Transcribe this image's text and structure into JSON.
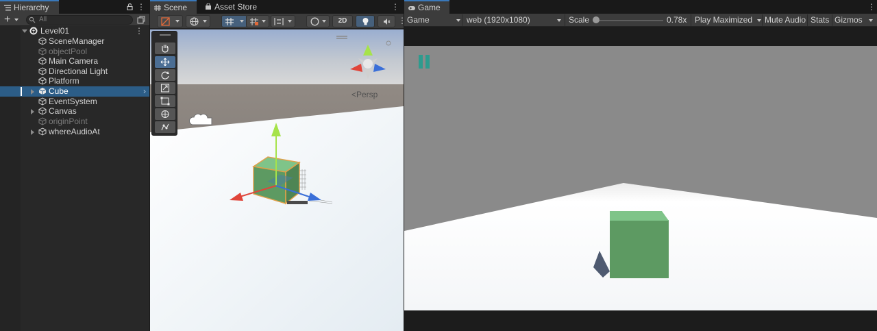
{
  "hierarchy": {
    "tab_label": "Hierarchy",
    "search_placeholder": "All",
    "scene_name": "Level01",
    "items": [
      {
        "label": "SceneManager"
      },
      {
        "label": "objectPool"
      },
      {
        "label": "Main Camera"
      },
      {
        "label": "Directional Light"
      },
      {
        "label": "Platform"
      },
      {
        "label": "Cube"
      },
      {
        "label": "EventSystem"
      },
      {
        "label": "Canvas"
      },
      {
        "label": "originPoint"
      },
      {
        "label": "whereAudioAt"
      }
    ]
  },
  "scene": {
    "tab_label": "Scene",
    "asset_store_label": "Asset Store",
    "mode_2d_label": "2D",
    "projection_label": "<Persp"
  },
  "game": {
    "tab_label": "Game",
    "display_select": "Game",
    "resolution_select": "web (1920x1080)",
    "scale_label": "Scale",
    "scale_value": "0.78x",
    "scale_fraction": 0.0,
    "play_mode_select": "Play Maximized",
    "mute_label": "Mute Audio",
    "stats_label": "Stats",
    "gizmos_label": "Gizmos"
  },
  "colors": {
    "selection": "#2c5d87",
    "accent": "#3a79bb",
    "cube_green": "#5d9a62",
    "cube_top": "#7fc489",
    "pause_teal": "#2e9b8e",
    "game_sky": "#8a8a8a",
    "floor_white": "#ffffff",
    "axis_x": "#e0453a",
    "axis_y": "#a6e34a",
    "axis_z": "#3a6fd8"
  },
  "icons": {
    "hierarchy_tab": "list-icon",
    "asset_store_tab": "bag-icon",
    "game_tab": "gamepad-icon",
    "scene_tab": "grid-icon"
  }
}
